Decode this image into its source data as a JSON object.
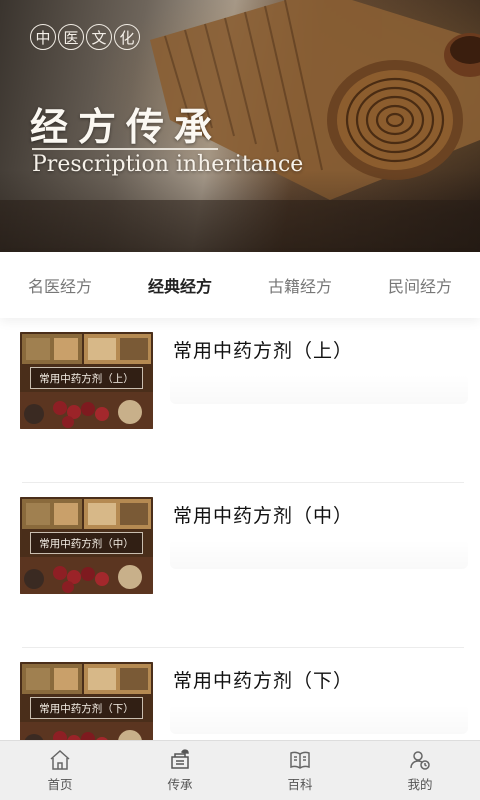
{
  "banner": {
    "seal_chars": [
      "中",
      "医",
      "文",
      "化"
    ],
    "title": "经方传承",
    "subtitle": "Prescription inheritance"
  },
  "tabs": [
    {
      "label": "名医经方",
      "active": false
    },
    {
      "label": "经典经方",
      "active": true
    },
    {
      "label": "古籍经方",
      "active": false
    },
    {
      "label": "民间经方",
      "active": false
    }
  ],
  "items": [
    {
      "title": "常用中药方剂（上）",
      "thumb_label": "常用中药方剂（上）"
    },
    {
      "title": "常用中药方剂（中）",
      "thumb_label": "常用中药方剂（中）"
    },
    {
      "title": "常用中药方剂（下）",
      "thumb_label": "常用中药方剂（下）"
    }
  ],
  "bottom_nav": [
    {
      "label": "首页",
      "icon": "home-icon"
    },
    {
      "label": "传承",
      "icon": "inherit-icon"
    },
    {
      "label": "百科",
      "icon": "encyclopedia-icon"
    },
    {
      "label": "我的",
      "icon": "profile-icon"
    }
  ],
  "colors": {
    "active_tab": "#222222",
    "inactive_tab": "#777777",
    "nav_bg": "#efefef"
  }
}
